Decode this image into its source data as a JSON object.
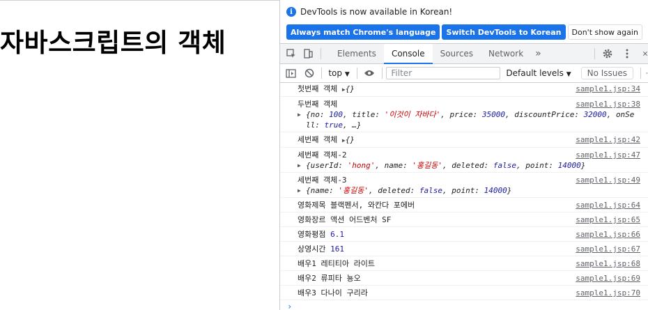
{
  "page": {
    "title": "자바스크립트의 객체"
  },
  "devtools": {
    "info": {
      "message": "DevTools is now available in Korean!",
      "buttons": [
        "Always match Chrome's language",
        "Switch DevTools to Korean",
        "Don't show again"
      ]
    },
    "tabs": [
      "Elements",
      "Console",
      "Sources",
      "Network"
    ],
    "active_tab": "Console",
    "filter": {
      "context": "top",
      "placeholder": "Filter",
      "levels": "Default levels",
      "issues": "No Issues"
    },
    "console": {
      "messages": [
        {
          "text": "첫번째 객체 ",
          "obj": "{}",
          "source": "sample1.jsp:34"
        },
        {
          "text": "두번째 객체",
          "source": "sample1.jsp:38"
        },
        {
          "text": "세번째 객체 ",
          "obj": "{}",
          "source": "sample1.jsp:42"
        },
        {
          "text": "세번째 객체-2",
          "source": "sample1.jsp:47"
        },
        {
          "text": "세번째 객체-3",
          "source": "sample1.jsp:49"
        },
        {
          "text": "영화제목 블랙펜서, 와칸다 포에버",
          "source": "sample1.jsp:64"
        },
        {
          "text": "영화장르 액션 어드벤처 SF",
          "source": "sample1.jsp:65"
        },
        {
          "text": "영화평점 ",
          "value": "6.1",
          "source": "sample1.jsp:66"
        },
        {
          "text": "상영시간 ",
          "value": "161",
          "source": "sample1.jsp:67"
        },
        {
          "text": "배우1 레티티아 라이트",
          "source": "sample1.jsp:68"
        },
        {
          "text": "배우2 류피타 뇽오",
          "source": "sample1.jsp:69"
        },
        {
          "text": "배우3 다나이 구리라",
          "source": "sample1.jsp:70"
        }
      ],
      "obj2": {
        "keys": [
          "no",
          "title",
          "price",
          "discountPrice",
          "onSell"
        ],
        "values": [
          "100",
          "'이것이 자바다'",
          "35000",
          "32000",
          "true"
        ],
        "ellipsis": "…"
      },
      "obj3": {
        "keys": [
          "userId",
          "name",
          "deleted",
          "point"
        ],
        "values": [
          "'hong'",
          "'홍길동'",
          "false",
          "14000"
        ]
      },
      "obj4": {
        "keys": [
          "name",
          "deleted",
          "point"
        ],
        "values": [
          "'홍길동'",
          "false",
          "14000"
        ]
      },
      "prompt": "›"
    }
  }
}
